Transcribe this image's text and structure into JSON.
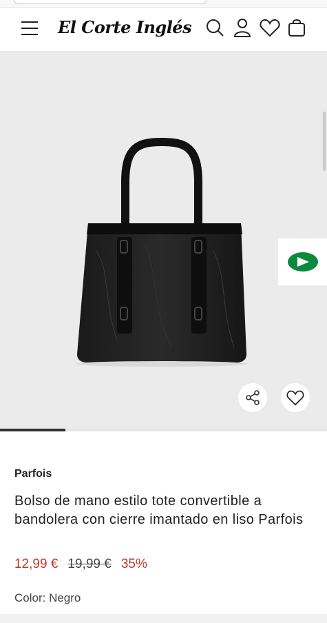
{
  "header": {
    "logo_text": "El Corte Inglés",
    "icons": [
      "menu-icon",
      "search-icon",
      "user-icon",
      "heart-icon",
      "bag-icon"
    ]
  },
  "gallery": {
    "image_alt": "Black tote handbag",
    "progress": 0.2,
    "actions": [
      "share-icon",
      "heart-icon"
    ],
    "side_tab_icon": "play-badge-icon",
    "colors": {
      "bg": "#ebebeb",
      "badge": "#0b8a3e"
    }
  },
  "product": {
    "brand": "Parfois",
    "title": "Bolso de mano estilo tote convertible a bandolera con cierre imantado en liso Parfois",
    "price_current": "12,99 €",
    "price_original": "19,99 €",
    "discount": "35%",
    "color_label": "Color: Negro",
    "colors": {
      "price": "#c0392b"
    }
  }
}
